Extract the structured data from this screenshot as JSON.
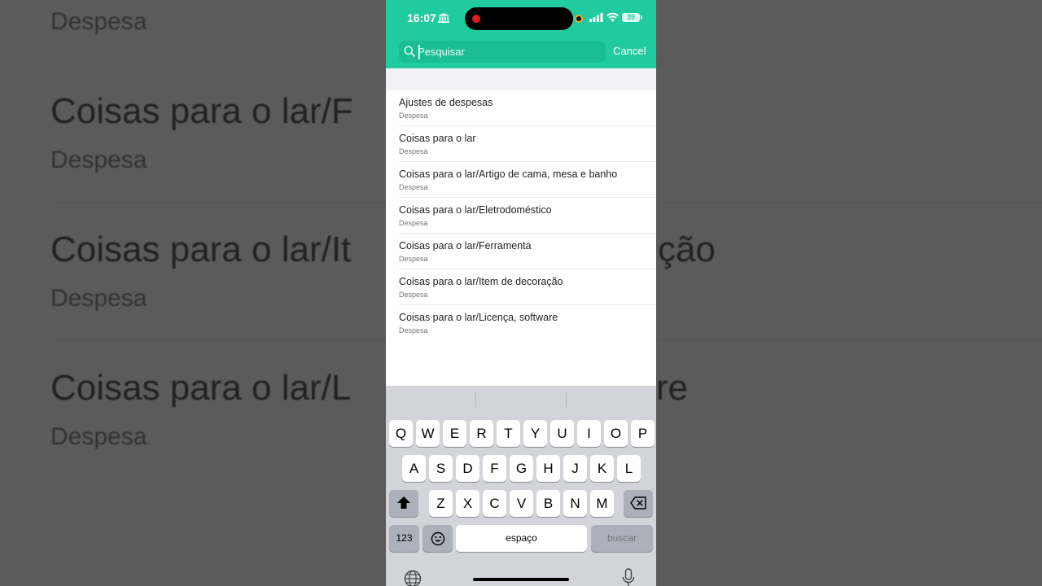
{
  "background": {
    "rows": [
      {
        "title": "",
        "sub": "Despesa"
      },
      {
        "title": "Coisas para o lar/F",
        "sub": "Despesa"
      },
      {
        "title": "Coisas para o lar/It",
        "title_tail": "ção",
        "sub": "Despesa"
      },
      {
        "title": "Coisas para o lar/L",
        "title_tail": "re",
        "sub": "Despesa"
      }
    ]
  },
  "status_bar": {
    "time": "16:07",
    "battery": "39"
  },
  "search": {
    "placeholder": "Pesquisar",
    "value": "",
    "cancel_label": "Cancel"
  },
  "results": [
    {
      "title": "Ajustes de despesas",
      "sub": "Despesa"
    },
    {
      "title": "Coisas para o lar",
      "sub": "Despesa"
    },
    {
      "title": "Coisas para o lar/Artigo de cama, mesa e banho",
      "sub": "Despesa"
    },
    {
      "title": "Coisas para o lar/Eletrodoméstico",
      "sub": "Despesa"
    },
    {
      "title": "Coisas para o lar/Ferramenta",
      "sub": "Despesa"
    },
    {
      "title": "Coisas para o lar/Item de decoração",
      "sub": "Despesa"
    },
    {
      "title": "Coisas para o lar/Licença, software",
      "sub": "Despesa"
    }
  ],
  "keyboard": {
    "row1": [
      "Q",
      "W",
      "E",
      "R",
      "T",
      "Y",
      "U",
      "I",
      "O",
      "P"
    ],
    "row2": [
      "A",
      "S",
      "D",
      "F",
      "G",
      "H",
      "J",
      "K",
      "L"
    ],
    "row3": [
      "Z",
      "X",
      "C",
      "V",
      "B",
      "N",
      "M"
    ],
    "numbers_label": "123",
    "space_label": "espaço",
    "search_label": "buscar"
  },
  "colors": {
    "accent": "#21cba0",
    "recording": "#e01d1d"
  }
}
